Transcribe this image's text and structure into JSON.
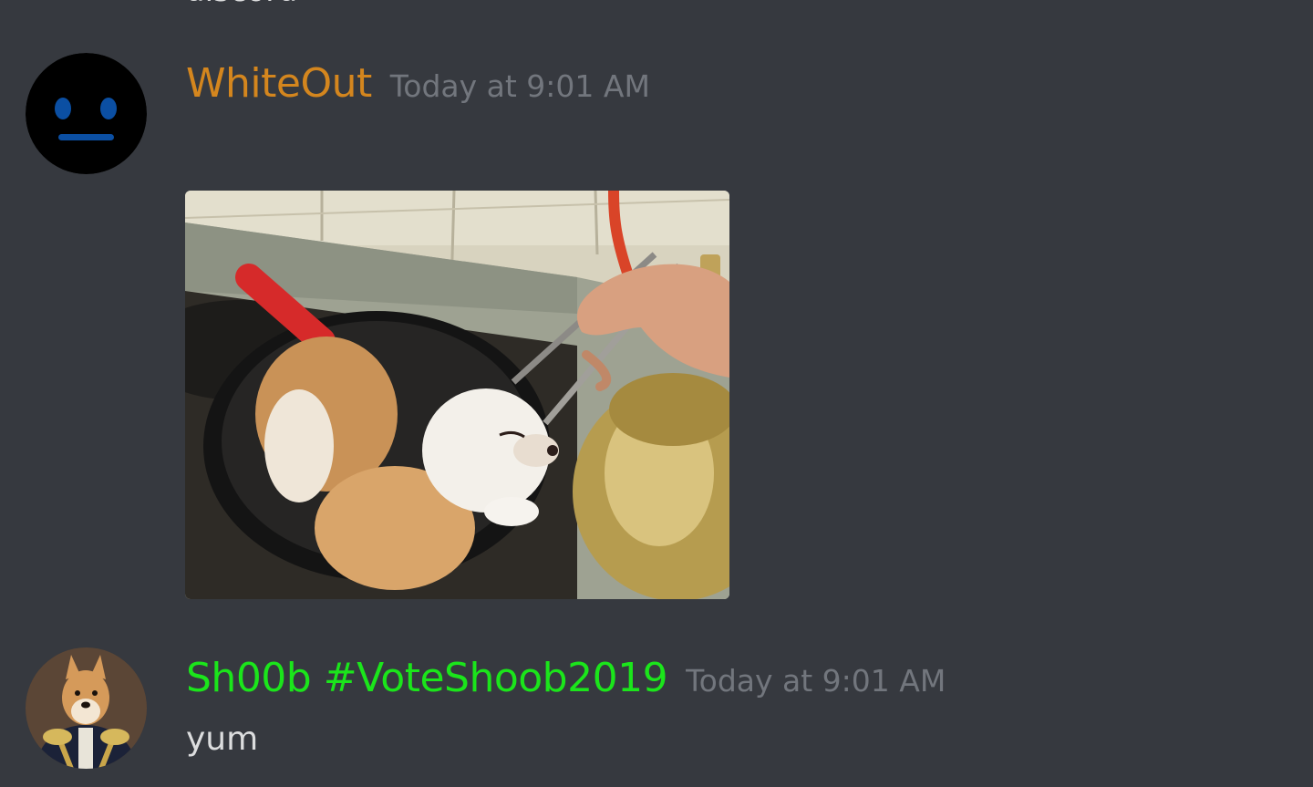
{
  "previous_message": {
    "text": "discord"
  },
  "messages": [
    {
      "username": "WhiteOut",
      "username_color": "#d4861e",
      "timestamp": "Today at 9:01 AM",
      "avatar_icon": "neutral-face-avatar-icon",
      "attachment_icon": "puppies-in-pot-image"
    },
    {
      "username": "Sh00b #VoteShoob2019",
      "username_color": "#1be51b",
      "timestamp": "Today at 9:01 AM",
      "avatar_icon": "shiba-dog-portrait-avatar-icon",
      "text": "yum"
    }
  ],
  "colors": {
    "background": "#36393f",
    "text": "#dcddde",
    "timestamp": "#72767d"
  }
}
